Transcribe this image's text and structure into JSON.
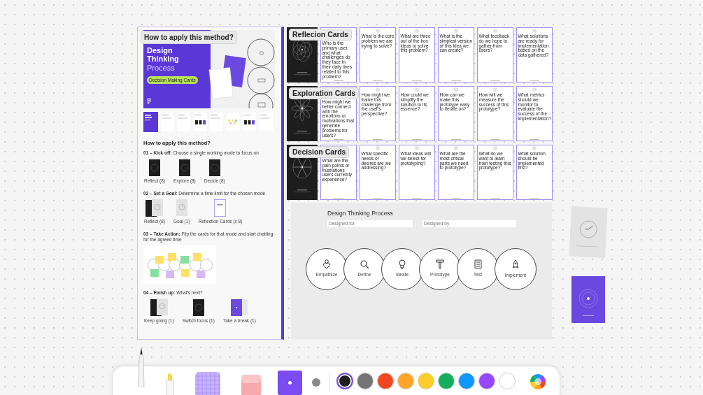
{
  "guide_panel": {
    "label": "How to apply this method?",
    "hero": {
      "title": "Design Thinking",
      "subtitle": "Process",
      "pill": "Decision Making Cards"
    },
    "thumbnails": [
      {
        "kind": "cover"
      },
      {
        "kind": "page"
      },
      {
        "kind": "page"
      },
      {
        "kind": "dark-cards"
      },
      {
        "kind": "page"
      },
      {
        "kind": "stickies"
      },
      {
        "kind": "dark-cards"
      },
      {
        "kind": "page"
      }
    ],
    "heading": "How to apply this method?",
    "steps": [
      {
        "text": "**01 – Kick off:** Choose a single working mode to focus on",
        "kind": "cards",
        "cards": [
          {
            "kind": "dark",
            "caption": "Reflect (8)"
          },
          {
            "kind": "dark",
            "caption": "Explore (8)"
          },
          {
            "kind": "dark",
            "caption": "Decide (8)"
          }
        ]
      },
      {
        "text": "**02 – Set a Goal:** Determine a time limit for the chosen mode",
        "kind": "cards",
        "cards": [
          {
            "kind": "dark-clock",
            "caption": "Reflect (8)"
          },
          {
            "kind": "clock",
            "caption": "Goal (1)"
          },
          {
            "kind": "white",
            "caption": "Reflection Cards (x 8)"
          }
        ]
      },
      {
        "text": "**03 – Take Action:** Flip the cards for that mode and start chatting for the agreed time",
        "kind": "diagram"
      },
      {
        "text": "**04 – Finish up:** What's next?",
        "kind": "cards",
        "cards": [
          {
            "kind": "dark-clock",
            "caption": "Keep going (1)"
          },
          {
            "kind": "dark",
            "caption": "Switch focus (1)"
          },
          {
            "kind": "purple",
            "caption": "Take a break (1)"
          }
        ]
      }
    ]
  },
  "decks": [
    {
      "label": "Reflecion Cards",
      "kind": "rings",
      "cards": [
        "Who is the primary user, and what challenges do they face in their daily lives related to this problem?",
        "What is the core problem we are trying to solve?",
        "What are three out of the box ideas to solve this problem?",
        "What is the simplest version of this idea we can create?",
        "What feedback do we hope to gather from users?",
        "What solutions are ready for implementation based on the data gathered?"
      ]
    },
    {
      "label": "Exploration Cards",
      "kind": "flower",
      "cards": [
        "How might we better connect with the emotions or motivations that generate problems for users?",
        "How might we frame this challenge from the user's perspective?",
        "How could we simplify the solution to its essence?",
        "How can we make this prototype easy to iterate on?",
        "How will we measure the success of this prototype?",
        "What metrics should we monitor to evaluate the success of the implementation?"
      ]
    },
    {
      "label": "Decision Cards",
      "kind": "grid",
      "cards": [
        "What are the pain points or frustrations users currently experience?",
        "What specific needs or desires are we addressing?",
        "What ideas will we select for prototyping?",
        "What are the most critical parts we need to prototype?",
        "What do we want to learn from testing this prototype?",
        "What solution should be implemented first?"
      ]
    }
  ],
  "process_board": {
    "title": "Design Thinking Process",
    "fields": [
      {
        "label": "Designed for"
      },
      {
        "label": "Designed by"
      }
    ],
    "stages": [
      "Empathize",
      "Define",
      "Ideate",
      "Prototype",
      "Test",
      "Implement"
    ]
  },
  "floating_cards": [
    {
      "kind": "clock"
    },
    {
      "kind": "purple"
    }
  ],
  "toolbar": {
    "tools": [
      {
        "kind": "pen",
        "selected": true
      },
      {
        "kind": "highlighter",
        "selected": false
      },
      {
        "kind": "tape",
        "selected": false
      },
      {
        "kind": "eraser",
        "selected": false
      }
    ],
    "sizes": [
      {
        "selected": true
      },
      {
        "selected": false
      }
    ],
    "colors": [
      {
        "color": "#1e1e1e",
        "selected": true
      },
      {
        "color": "#757575",
        "selected": false
      },
      {
        "color": "#f24822",
        "selected": false
      },
      {
        "color": "#ffa629",
        "selected": false
      },
      {
        "color": "#ffcd29",
        "selected": false
      },
      {
        "color": "#14ae5c",
        "selected": false
      },
      {
        "color": "#0d99ff",
        "selected": false
      },
      {
        "color": "#9747ff",
        "selected": false
      },
      {
        "color": "#ffffff",
        "selected": false
      }
    ]
  }
}
